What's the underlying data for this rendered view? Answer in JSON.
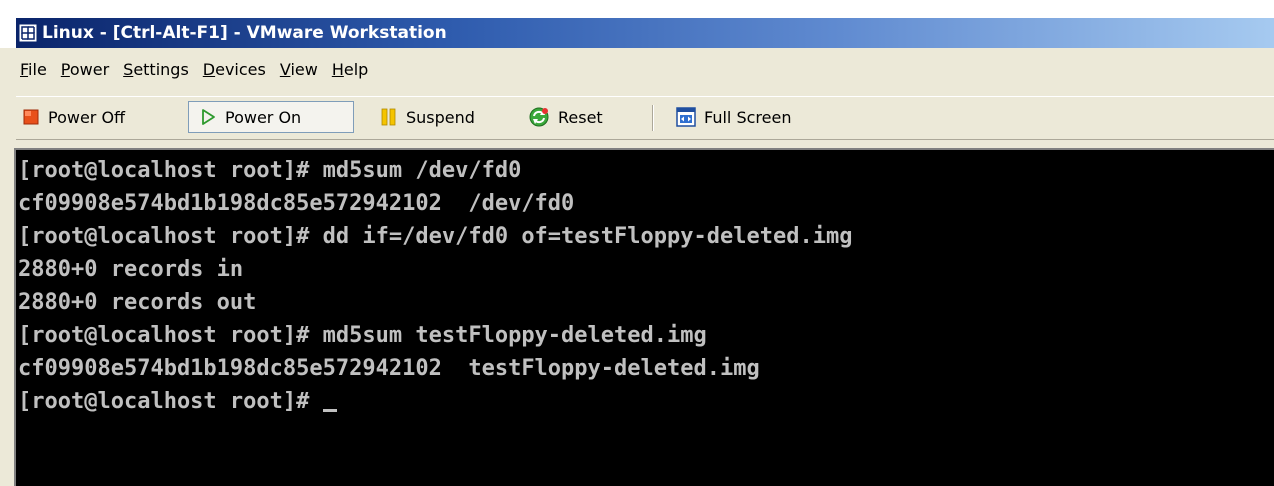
{
  "window": {
    "title": "Linux - [Ctrl-Alt-F1] - VMware Workstation"
  },
  "menu": {
    "items": [
      "File",
      "Power",
      "Settings",
      "Devices",
      "View",
      "Help"
    ]
  },
  "toolbar": {
    "power_off_label": "Power Off",
    "power_on_label": "Power On",
    "suspend_label": "Suspend",
    "reset_label": "Reset",
    "full_screen_label": "Full Screen"
  },
  "console": {
    "lines": [
      "[root@localhost root]# md5sum /dev/fd0",
      "cf09908e574bd1b198dc85e572942102  /dev/fd0",
      "[root@localhost root]# dd if=/dev/fd0 of=testFloppy-deleted.img",
      "2880+0 records in",
      "2880+0 records out",
      "[root@localhost root]# md5sum testFloppy-deleted.img",
      "cf09908e574bd1b198dc85e572942102  testFloppy-deleted.img"
    ],
    "prompt": "[root@localhost root]# "
  },
  "colors": {
    "title_gradient_start": "#0a246a",
    "title_gradient_end": "#a6caf0",
    "console_background": "#000000",
    "console_text": "#c0c0c0",
    "chrome_background": "#ece9d8"
  },
  "icons": {
    "app": "vmware-app-icon",
    "power_off": "red-square-icon",
    "power_on": "green-play-icon",
    "suspend": "yellow-pause-icon",
    "reset": "green-refresh-icon",
    "full_screen": "full-screen-icon"
  }
}
